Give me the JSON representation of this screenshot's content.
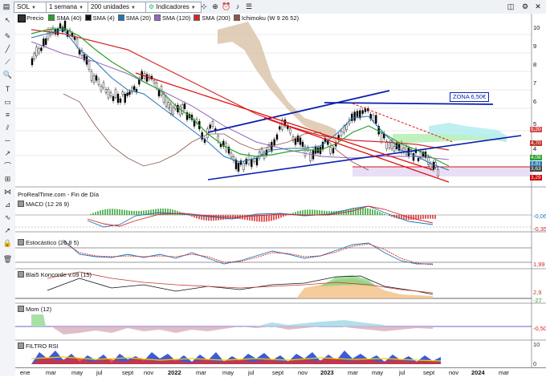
{
  "toolbar": {
    "symbol": "SOL",
    "period": "1 semana",
    "units": "200 unidades",
    "indicators": "Indicadores"
  },
  "legend": {
    "price_label": "Precio",
    "items": [
      {
        "label": "SMA (40)",
        "color": "#2ca02c"
      },
      {
        "label": "SMA (4)",
        "color": "#111111"
      },
      {
        "label": "SMA (20)",
        "color": "#1f77b4"
      },
      {
        "label": "SMA (120)",
        "color": "#9467bd"
      },
      {
        "label": "SMA (200)",
        "color": "#d62728"
      },
      {
        "label": "Ichimoku (W 9 26 52)",
        "color": "#8c564b"
      }
    ]
  },
  "main_chart": {
    "zone_label": "ZONA 6,50€",
    "source": "ProRealTime.com - Fin de Día",
    "y_ticks": [
      "10",
      "9",
      "8",
      "7",
      "6",
      "5",
      "4"
    ],
    "price_tags": [
      {
        "text": "5,20",
        "color": "#d84a4a"
      },
      {
        "text": "4,70",
        "color": "#c0392b"
      },
      {
        "text": "4,08",
        "color": "#2ca02c"
      },
      {
        "text": "3,81",
        "color": "#1f77b4"
      },
      {
        "text": "3,63",
        "color": "#444444"
      },
      {
        "text": "3,29",
        "color": "#cc0000"
      }
    ]
  },
  "panels": {
    "macd": {
      "title": "MACD (12 26 9)",
      "tags": [
        "-0,06",
        "-0,35"
      ]
    },
    "stochastic": {
      "title": "Estocástico (26 8 5)",
      "tags": [
        "1,99"
      ]
    },
    "koncorde": {
      "title": "Blai5 Koncorde v.09 (15)",
      "tags": [
        "2,9",
        "-27"
      ]
    },
    "momentum": {
      "title": "Mom (12)",
      "tags": [
        "-0,50"
      ]
    },
    "rsi": {
      "title": "FILTRO RSI",
      "tags": [
        "10",
        "0"
      ]
    }
  },
  "x_axis": {
    "labels": [
      {
        "text": "ene",
        "bold": false
      },
      {
        "text": "mar",
        "bold": false
      },
      {
        "text": "may",
        "bold": false
      },
      {
        "text": "jul",
        "bold": false
      },
      {
        "text": "sept",
        "bold": false
      },
      {
        "text": "nov",
        "bold": false
      },
      {
        "text": "2022",
        "bold": true
      },
      {
        "text": "mar",
        "bold": false
      },
      {
        "text": "may",
        "bold": false
      },
      {
        "text": "jul",
        "bold": false
      },
      {
        "text": "sept",
        "bold": false
      },
      {
        "text": "nov",
        "bold": false
      },
      {
        "text": "2023",
        "bold": true
      },
      {
        "text": "mar",
        "bold": false
      },
      {
        "text": "may",
        "bold": false
      },
      {
        "text": "jul",
        "bold": false
      },
      {
        "text": "sept",
        "bold": false
      },
      {
        "text": "nov",
        "bold": false
      },
      {
        "text": "2024",
        "bold": true
      },
      {
        "text": "mar",
        "bold": false
      }
    ]
  },
  "colors": {
    "trend_blue": "#0a1fb0",
    "trend_red": "#e01010",
    "cloud_tan": "#d9c2a8",
    "cloud_green": "#b8f0b8",
    "cloud_cyan": "#b8eef0"
  }
}
